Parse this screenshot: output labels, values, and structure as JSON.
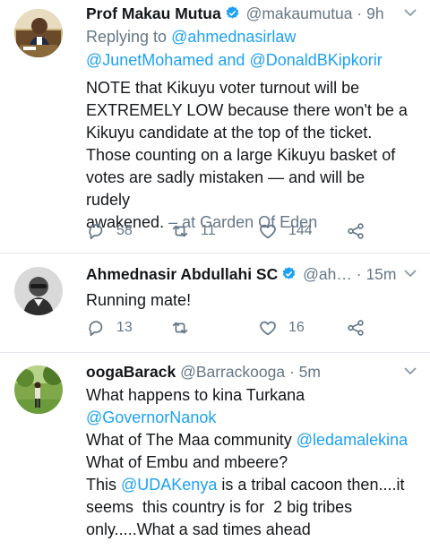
{
  "colors": {
    "link": "#1da1f2",
    "muted": "#657786",
    "text": "#14171a",
    "verified": "#1da1f2",
    "divider": "#e1e8ed"
  },
  "tweets": [
    {
      "name": "Prof Makau Mutua",
      "handle": "@makaumutua",
      "time": "9h",
      "verified": true,
      "reply_label": "Replying to",
      "reply_mention_1": "@ahmednasirlaw",
      "reply_mention_2": "@JunetMohamed",
      "reply_and": "and",
      "reply_mention_3": "@DonaldBKipkorir",
      "text_lines": [
        "NOTE that Kikuyu voter turnout will be",
        "EXTREMELY LOW because there won't be a",
        "Kikuyu candidate at the top of the ticket.",
        "Those counting on a large Kikuyu basket of",
        "votes are sadly mistaken — and will be rudely"
      ],
      "last_line_text": "awakened.",
      "place": "– at Garden Of Eden",
      "replies": "58",
      "retweets": "11",
      "likes": "144"
    },
    {
      "name": "Ahmednasir Abdullahi SC",
      "handle": "@ah…",
      "time": "15m",
      "verified": true,
      "text": "Running mate!",
      "replies": "13",
      "retweets": "",
      "likes": "16"
    },
    {
      "name": "oogaBarack",
      "handle": "@Barrackooga",
      "time": "5m",
      "verified": false,
      "line_1": "What happens to kina Turkana",
      "line_2_mention": "@GovernorNanok",
      "line_3_text": "What of The Maa community ",
      "line_3_mention": "@ledamalekina",
      "line_4": "What of Embu and mbeere?",
      "line_5_pre": "This ",
      "line_5_mention": "@UDAKenya",
      "line_5_post": " is a tribal cacoon then....it",
      "line_6": "seems  this country is for  2 big tribes",
      "line_7": "only.....What a sad times ahead"
    }
  ]
}
